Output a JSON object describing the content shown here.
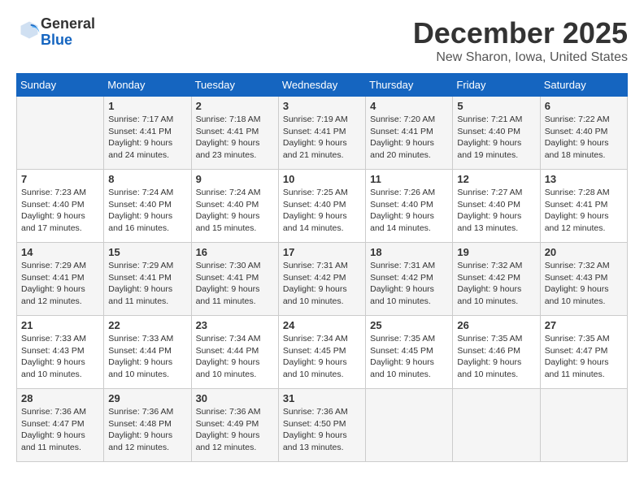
{
  "logo": {
    "general": "General",
    "blue": "Blue"
  },
  "title": "December 2025",
  "location": "New Sharon, Iowa, United States",
  "weekdays": [
    "Sunday",
    "Monday",
    "Tuesday",
    "Wednesday",
    "Thursday",
    "Friday",
    "Saturday"
  ],
  "weeks": [
    [
      {
        "day": "",
        "info": ""
      },
      {
        "day": "1",
        "info": "Sunrise: 7:17 AM\nSunset: 4:41 PM\nDaylight: 9 hours\nand 24 minutes."
      },
      {
        "day": "2",
        "info": "Sunrise: 7:18 AM\nSunset: 4:41 PM\nDaylight: 9 hours\nand 23 minutes."
      },
      {
        "day": "3",
        "info": "Sunrise: 7:19 AM\nSunset: 4:41 PM\nDaylight: 9 hours\nand 21 minutes."
      },
      {
        "day": "4",
        "info": "Sunrise: 7:20 AM\nSunset: 4:41 PM\nDaylight: 9 hours\nand 20 minutes."
      },
      {
        "day": "5",
        "info": "Sunrise: 7:21 AM\nSunset: 4:40 PM\nDaylight: 9 hours\nand 19 minutes."
      },
      {
        "day": "6",
        "info": "Sunrise: 7:22 AM\nSunset: 4:40 PM\nDaylight: 9 hours\nand 18 minutes."
      }
    ],
    [
      {
        "day": "7",
        "info": "Sunrise: 7:23 AM\nSunset: 4:40 PM\nDaylight: 9 hours\nand 17 minutes."
      },
      {
        "day": "8",
        "info": "Sunrise: 7:24 AM\nSunset: 4:40 PM\nDaylight: 9 hours\nand 16 minutes."
      },
      {
        "day": "9",
        "info": "Sunrise: 7:24 AM\nSunset: 4:40 PM\nDaylight: 9 hours\nand 15 minutes."
      },
      {
        "day": "10",
        "info": "Sunrise: 7:25 AM\nSunset: 4:40 PM\nDaylight: 9 hours\nand 14 minutes."
      },
      {
        "day": "11",
        "info": "Sunrise: 7:26 AM\nSunset: 4:40 PM\nDaylight: 9 hours\nand 14 minutes."
      },
      {
        "day": "12",
        "info": "Sunrise: 7:27 AM\nSunset: 4:40 PM\nDaylight: 9 hours\nand 13 minutes."
      },
      {
        "day": "13",
        "info": "Sunrise: 7:28 AM\nSunset: 4:41 PM\nDaylight: 9 hours\nand 12 minutes."
      }
    ],
    [
      {
        "day": "14",
        "info": "Sunrise: 7:29 AM\nSunset: 4:41 PM\nDaylight: 9 hours\nand 12 minutes."
      },
      {
        "day": "15",
        "info": "Sunrise: 7:29 AM\nSunset: 4:41 PM\nDaylight: 9 hours\nand 11 minutes."
      },
      {
        "day": "16",
        "info": "Sunrise: 7:30 AM\nSunset: 4:41 PM\nDaylight: 9 hours\nand 11 minutes."
      },
      {
        "day": "17",
        "info": "Sunrise: 7:31 AM\nSunset: 4:42 PM\nDaylight: 9 hours\nand 10 minutes."
      },
      {
        "day": "18",
        "info": "Sunrise: 7:31 AM\nSunset: 4:42 PM\nDaylight: 9 hours\nand 10 minutes."
      },
      {
        "day": "19",
        "info": "Sunrise: 7:32 AM\nSunset: 4:42 PM\nDaylight: 9 hours\nand 10 minutes."
      },
      {
        "day": "20",
        "info": "Sunrise: 7:32 AM\nSunset: 4:43 PM\nDaylight: 9 hours\nand 10 minutes."
      }
    ],
    [
      {
        "day": "21",
        "info": "Sunrise: 7:33 AM\nSunset: 4:43 PM\nDaylight: 9 hours\nand 10 minutes."
      },
      {
        "day": "22",
        "info": "Sunrise: 7:33 AM\nSunset: 4:44 PM\nDaylight: 9 hours\nand 10 minutes."
      },
      {
        "day": "23",
        "info": "Sunrise: 7:34 AM\nSunset: 4:44 PM\nDaylight: 9 hours\nand 10 minutes."
      },
      {
        "day": "24",
        "info": "Sunrise: 7:34 AM\nSunset: 4:45 PM\nDaylight: 9 hours\nand 10 minutes."
      },
      {
        "day": "25",
        "info": "Sunrise: 7:35 AM\nSunset: 4:45 PM\nDaylight: 9 hours\nand 10 minutes."
      },
      {
        "day": "26",
        "info": "Sunrise: 7:35 AM\nSunset: 4:46 PM\nDaylight: 9 hours\nand 10 minutes."
      },
      {
        "day": "27",
        "info": "Sunrise: 7:35 AM\nSunset: 4:47 PM\nDaylight: 9 hours\nand 11 minutes."
      }
    ],
    [
      {
        "day": "28",
        "info": "Sunrise: 7:36 AM\nSunset: 4:47 PM\nDaylight: 9 hours\nand 11 minutes."
      },
      {
        "day": "29",
        "info": "Sunrise: 7:36 AM\nSunset: 4:48 PM\nDaylight: 9 hours\nand 12 minutes."
      },
      {
        "day": "30",
        "info": "Sunrise: 7:36 AM\nSunset: 4:49 PM\nDaylight: 9 hours\nand 12 minutes."
      },
      {
        "day": "31",
        "info": "Sunrise: 7:36 AM\nSunset: 4:50 PM\nDaylight: 9 hours\nand 13 minutes."
      },
      {
        "day": "",
        "info": ""
      },
      {
        "day": "",
        "info": ""
      },
      {
        "day": "",
        "info": ""
      }
    ]
  ]
}
